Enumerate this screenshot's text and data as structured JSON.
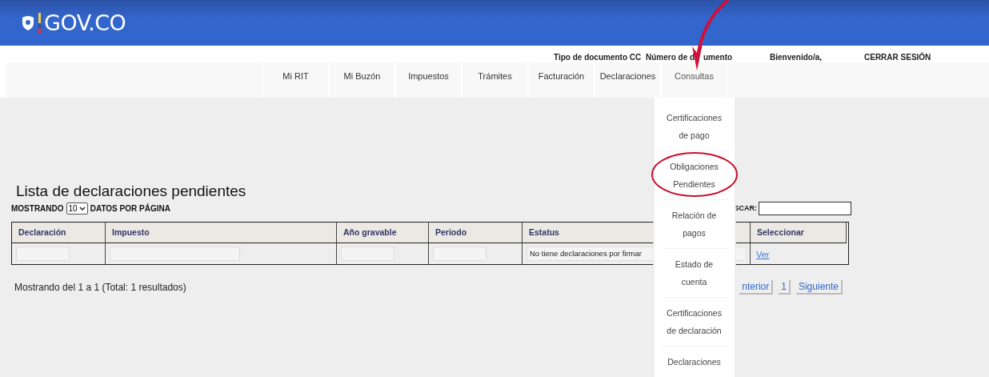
{
  "header": {
    "logo_text": "GOV.CO"
  },
  "user_bar": [
    "Tipo de documento CC",
    "Número de d",
    "umento",
    "Bienvenido/a,",
    "CERRAR SESIÓN"
  ],
  "nav": {
    "items": [
      {
        "label": "Mi RIT",
        "expanded": false
      },
      {
        "label": "Mi Buzón",
        "expanded": false
      },
      {
        "label": "Impuestos",
        "expanded": false
      },
      {
        "label": "Trámites",
        "expanded": false
      },
      {
        "label": "Facturación",
        "expanded": false
      },
      {
        "label": "Declaraciones",
        "expanded": false
      },
      {
        "label": "Consultas",
        "expanded": true,
        "menu": [
          "Certificaciones de pago",
          "Obligaciones Pendientes",
          "Relación de pagos",
          "Estado de cuenta",
          "Certificaciones de declaración",
          "Declaraciones"
        ]
      }
    ]
  },
  "page": {
    "title": "Lista de declaraciones pendientes",
    "show_prefix": "MOSTRANDO",
    "page_size": "10",
    "show_suffix": "DATOS POR PÁGINA",
    "search_label": "SCAR:"
  },
  "table": {
    "columns": [
      "Declaración",
      "Impuesto",
      "Año gravable",
      "Periodo",
      "Estatus",
      "Seleccionar"
    ],
    "rows": [
      {
        "status": "No tiene declaraciones por firmar",
        "action": "Ver"
      }
    ]
  },
  "footer": {
    "summary": "Mostrando del 1 a 1 (Total: 1 resultados)",
    "pages": [
      "nterior",
      "1",
      "Siguiente"
    ]
  }
}
